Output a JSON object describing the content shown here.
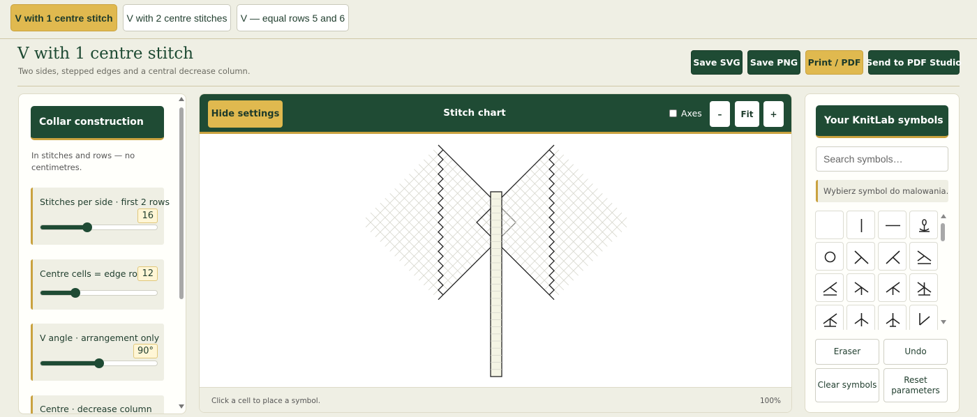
{
  "tabs": [
    {
      "label": "V with 1 centre stitch",
      "active": true
    },
    {
      "label": "V with 2 centre stitches",
      "active": false
    },
    {
      "label": "V — equal rows 5 and 6",
      "active": false
    }
  ],
  "header": {
    "title": "V with 1 centre stitch",
    "subtitle": "Two sides, stepped edges and a central decrease column.",
    "buttons": {
      "save_svg": "Save SVG",
      "save_png": "Save PNG",
      "print_pdf": "Print / PDF",
      "send_pdf_studio": "Send to PDF Studio"
    }
  },
  "settings": {
    "heading": "Collar construction",
    "note": "In stitches and rows — no centimetres.",
    "controls": [
      {
        "label": "Stitches per side · first 2 rows",
        "value": "16",
        "fraction": 0.4
      },
      {
        "label": "Centre cells = edge rows",
        "value": "12",
        "fraction": 0.3
      },
      {
        "label": "V angle · arrangement only",
        "value": "90°",
        "fraction": 0.5
      },
      {
        "label": "Centre · decrease column",
        "value": "",
        "fraction": 0
      }
    ]
  },
  "chart_panel": {
    "hide_settings": "Hide settings",
    "title": "Stitch chart",
    "axes_label": "Axes",
    "axes_checked": false,
    "zoom_out": "–",
    "zoom_fit": "Fit",
    "zoom_in": "+",
    "hint": "Click a cell to place a symbol.",
    "zoom": "100%",
    "chart": {
      "side_stitches": 16,
      "centre_cells": 12,
      "angle_deg": 90,
      "grid_color": "#d6d6cc",
      "outline_color": "#222222",
      "centre_fill": "#f4f4e4"
    }
  },
  "symbols_panel": {
    "heading": "Your KnitLab symbols",
    "search_placeholder": "Search symbols…",
    "hint": "Wybierz symbol do malowania.",
    "symbols": [
      "blank",
      "vertical-line",
      "horizontal-line",
      "bobble",
      "circle",
      "right-decrease",
      "left-decrease",
      "right-decrease-base",
      "left-decrease-base",
      "right-decrease-base-stem",
      "left-decrease-base-stem",
      "cdd-base",
      "left-cdd-base",
      "central-double-decrease",
      "central-double-decrease-stem",
      "corner-decrease"
    ],
    "buttons": {
      "eraser": "Eraser",
      "undo": "Undo",
      "clear_symbols": "Clear symbols",
      "reset_parameters": "Reset parameters"
    }
  }
}
